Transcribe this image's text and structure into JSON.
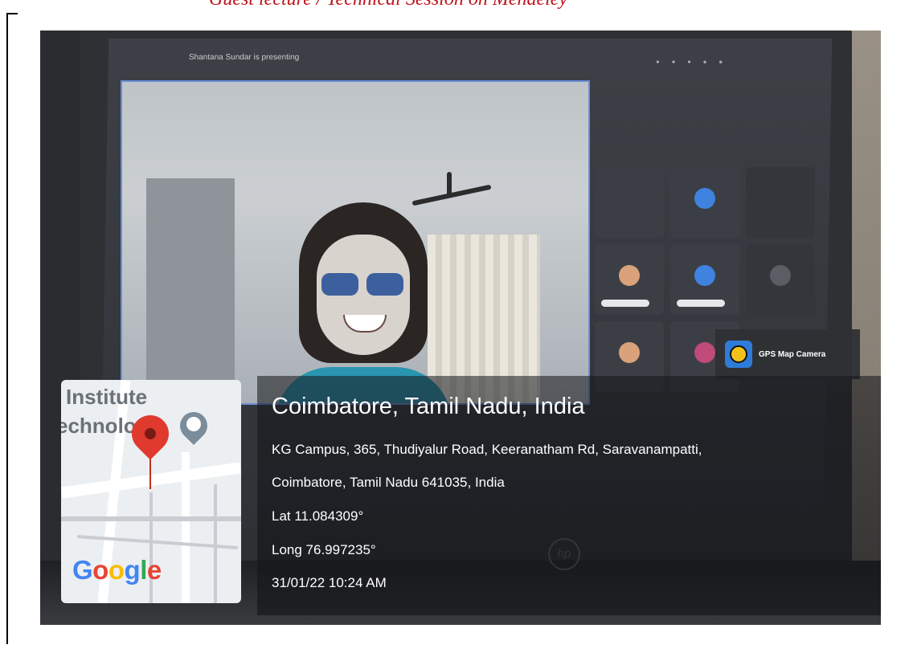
{
  "document": {
    "heading": "Guest lecture / Technical Session on Mendeley"
  },
  "screen": {
    "presenting_text": "Shantana Sundar is presenting",
    "toolbar_dots": "• • • ▪ ▪"
  },
  "gps_camera": {
    "label": "GPS Map Camera",
    "icon": "gps-map-camera-icon"
  },
  "map": {
    "label_line1": "Institute",
    "label_line2": "echnolo",
    "logo": "Google",
    "pin_color": "#e03a2e"
  },
  "location": {
    "city": "Coimbatore, Tamil Nadu, India",
    "address_line1": "KG Campus, 365, Thudiyalur Road, Keeranatham Rd, Saravanampatti,",
    "address_line2": "Coimbatore, Tamil Nadu 641035, India",
    "lat": "Lat 11.084309°",
    "long": "Long 76.997235°",
    "datetime": "31/01/22 10:24 AM"
  },
  "laptop": {
    "brand_mark": "hp"
  }
}
